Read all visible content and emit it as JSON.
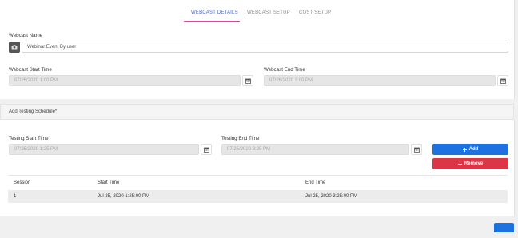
{
  "tabs": [
    {
      "label": "WEBCAST DETAILS",
      "active": true
    },
    {
      "label": "WEBCAST SETUP",
      "active": false
    },
    {
      "label": "COST SETUP",
      "active": false
    }
  ],
  "webcast": {
    "name_label": "Webcast Name",
    "name_value": "Webinar Event By user",
    "start_label": "Webcast Start Time",
    "start_value": "07/26/2020 1:00 PM",
    "end_label": "Webcast End Time",
    "end_value": "07/26/2020 3:00 PM"
  },
  "testing": {
    "section_title": "Add Testing Schedule*",
    "start_label": "Testing Start Time",
    "start_value": "07/25/2020 1:25 PM",
    "end_label": "Testing End Time",
    "end_value": "07/25/2020 3:25 PM",
    "add_label": "Add",
    "remove_label": "Remove"
  },
  "table": {
    "headers": [
      "Session",
      "Start Time",
      "End Time"
    ],
    "rows": [
      [
        "1",
        "Jul 25, 2020 1:25:00 PM",
        "Jul 25, 2020 3:25:00 PM"
      ]
    ]
  },
  "colors": {
    "accent": "#4a67c8",
    "tab_underline": "#d94a94",
    "primary": "#1e72e0",
    "danger": "#dc3545"
  },
  "icons": {
    "camera": "camera-icon",
    "calendar": "calendar-icon",
    "plus": "plus-icon",
    "minus": "minus-icon"
  }
}
